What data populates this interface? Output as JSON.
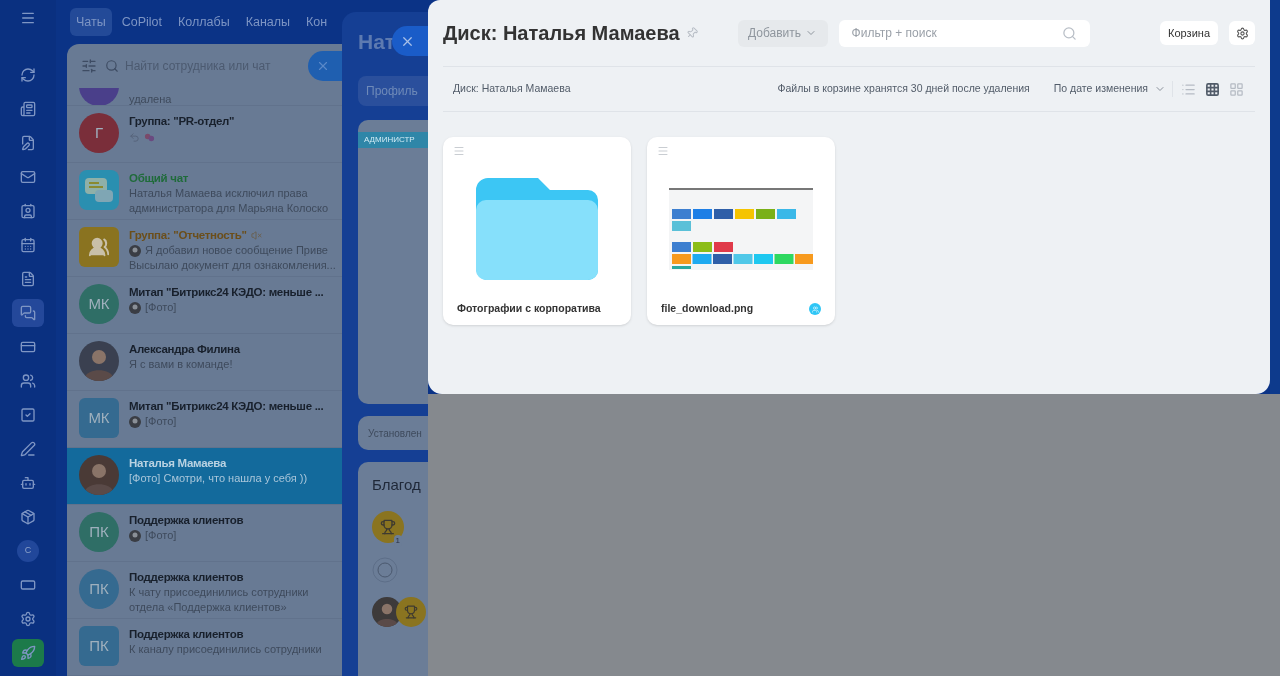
{
  "rail": [
    {
      "kind": "icon",
      "selected": false
    },
    {
      "kind": "icon",
      "selected": false
    },
    {
      "kind": "icon",
      "selected": false
    },
    {
      "kind": "icon",
      "selected": false
    },
    {
      "kind": "icon",
      "selected": false
    },
    {
      "kind": "icon",
      "selected": false
    },
    {
      "kind": "icon",
      "selected": false
    },
    {
      "kind": "icon",
      "selected": false
    },
    {
      "kind": "icon",
      "selected": true
    },
    {
      "kind": "icon",
      "selected": false
    },
    {
      "kind": "icon",
      "selected": false
    },
    {
      "kind": "icon",
      "selected": false
    },
    {
      "kind": "icon",
      "selected": false
    },
    {
      "kind": "icon",
      "selected": false
    },
    {
      "kind": "icon",
      "selected": false
    },
    {
      "kind": "avatar",
      "text": "С",
      "selected": false
    },
    {
      "kind": "icon",
      "selected": false
    },
    {
      "kind": "icon",
      "selected": false
    },
    {
      "kind": "icon",
      "selected": false
    }
  ],
  "top_tabs": [
    {
      "label": "Чаты",
      "selected": true
    },
    {
      "label": "CoPilot",
      "selected": false
    },
    {
      "label": "Коллабы",
      "selected": false
    },
    {
      "label": "Каналы",
      "selected": false
    },
    {
      "label": "Кон",
      "selected": false
    }
  ],
  "chat_search": {
    "placeholder": "Найти сотрудника или чат"
  },
  "chats": [
    {
      "kind": "partial",
      "selected": false,
      "color": "#4a3f8a",
      "preview": "удалена"
    },
    {
      "kind": "initials",
      "selected": false,
      "color": "#7a2e3a",
      "initials": "Г",
      "title": "Группа: \"PR-отдел\"",
      "preview_icons": true
    },
    {
      "kind": "general",
      "selected": false,
      "color": "#2a8fb0",
      "title": "Общий чат",
      "preview": "Наталья Мамаева исключил права",
      "preview2": "администратора для Марьяна Колоско"
    },
    {
      "kind": "group",
      "selected": false,
      "color": "#8a7320",
      "title": "Группа: \"Отчетность\"",
      "muted": true,
      "author_avatar": true,
      "preview": "Я добавил новое сообщение Приве",
      "preview2": "Высылаю документ для ознакомления..."
    },
    {
      "kind": "initials",
      "selected": false,
      "color": "#2f6e66",
      "initials": "МК",
      "title": "Митап \"Битрикс24 КЭДО: меньше ...",
      "author_avatar": true,
      "preview": "[Фото]"
    },
    {
      "kind": "photo",
      "selected": false,
      "color": "#3a4050",
      "title": "Александра Филина",
      "preview": "Я с вами в команде!"
    },
    {
      "kind": "square",
      "selected": false,
      "color": "#356a90",
      "initials": "МК",
      "title": "Митап \"Битрикс24 КЭДО: меньше ...",
      "author_avatar": true,
      "preview": "[Фото]"
    },
    {
      "kind": "photo",
      "selected": true,
      "color": "#4a3a36",
      "title": "Наталья Мамаева",
      "preview": "[Фото] Смотри, что нашла у себя ))"
    },
    {
      "kind": "initials",
      "selected": false,
      "color": "#2f6e66",
      "initials": "ПК",
      "title": "Поддержка клиентов",
      "author_avatar": true,
      "preview": "[Фото]"
    },
    {
      "kind": "initials",
      "selected": false,
      "color": "#356a90",
      "initials": "ПК",
      "title": "Поддержка клиентов",
      "preview": "К чату присоединились сотрудники",
      "preview2": "отдела «Поддержка клиентов»"
    },
    {
      "kind": "square",
      "selected": false,
      "color": "#356a90",
      "initials": "ПК",
      "title": "Поддержка клиентов",
      "preview": "К каналу присоединились сотрудники"
    }
  ],
  "profile": {
    "title": "Нат",
    "tab": "Профиль",
    "role": "АДМИНИСТР",
    "status": "Установлен",
    "thanks_title": "Благод",
    "badge_count": "1"
  },
  "disk": {
    "title": "Диск: Наталья Мамаева",
    "add_button": {
      "label": "Добавить",
      "disabled": true
    },
    "search": {
      "placeholder": "Фильтр + поиск"
    },
    "trash_button": "Корзина",
    "breadcrumb": "Диск: Наталья Мамаева",
    "notice": "Файлы в корзине хранятся 30 дней после удаления",
    "sort": "По дате изменения",
    "view_modes": [
      {
        "kind": "list",
        "selected": false
      },
      {
        "kind": "grid",
        "selected": true
      },
      {
        "kind": "tiles",
        "selected": false
      }
    ],
    "files": [
      {
        "kind": "folder",
        "name": "Фотографии с корпоратива",
        "shared": false
      },
      {
        "kind": "image",
        "name": "file_download.png",
        "shared": true
      }
    ]
  }
}
